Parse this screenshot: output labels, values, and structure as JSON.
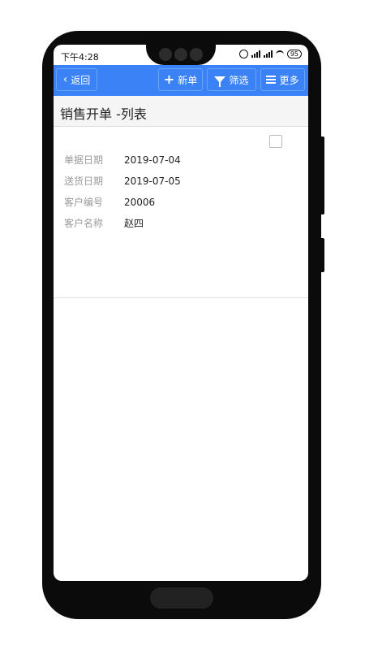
{
  "status_bar": {
    "time": "下午4:28",
    "battery": "95"
  },
  "toolbar": {
    "back_label": "返回",
    "new_label": "新单",
    "filter_label": "筛选",
    "more_label": "更多"
  },
  "page": {
    "title": "销售开单 -列表"
  },
  "record": {
    "fields": [
      {
        "label": "单据日期",
        "value": "2019-07-04"
      },
      {
        "label": "送货日期",
        "value": "2019-07-05"
      },
      {
        "label": "客户编号",
        "value": "20006"
      },
      {
        "label": "客户名称",
        "value": "赵四"
      }
    ]
  },
  "colors": {
    "toolbar": "#3b82f6",
    "frame": "#0b0b0b"
  }
}
